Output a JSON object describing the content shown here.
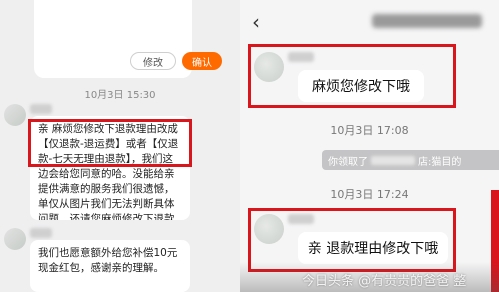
{
  "left": {
    "order_card": {
      "edit_label": "修改",
      "confirm_label": "确认"
    },
    "timestamp": "10月3日 15:30",
    "message1": "亲 麻烦您修改下退款理由改成【仅退款-退运费】或者【仅退款-七天无理由退款】，我们这边会给您同意的哈。没能给亲提供满意的服务我们很遗憾，单仅从图片我们无法判断具体问题，还请您麻烦修改下退款理由哦",
    "message2": "我们也愿意额外给您补偿10元现金红包，感谢亲的理解。"
  },
  "right": {
    "back_icon": "chevron-left-icon",
    "message1": "麻烦您修改下哦",
    "timestamp1": "10月3日 17:08",
    "notice_prefix": "你领取了",
    "notice_suffix": "店:猫目的",
    "timestamp2": "10月3日 17:24",
    "message2": "亲  退款理由修改下哦",
    "watermark": "今日头条 @有贵贵的爸爸 整"
  },
  "colors": {
    "highlight": "#d8161c",
    "confirm": "#ff6a00"
  }
}
